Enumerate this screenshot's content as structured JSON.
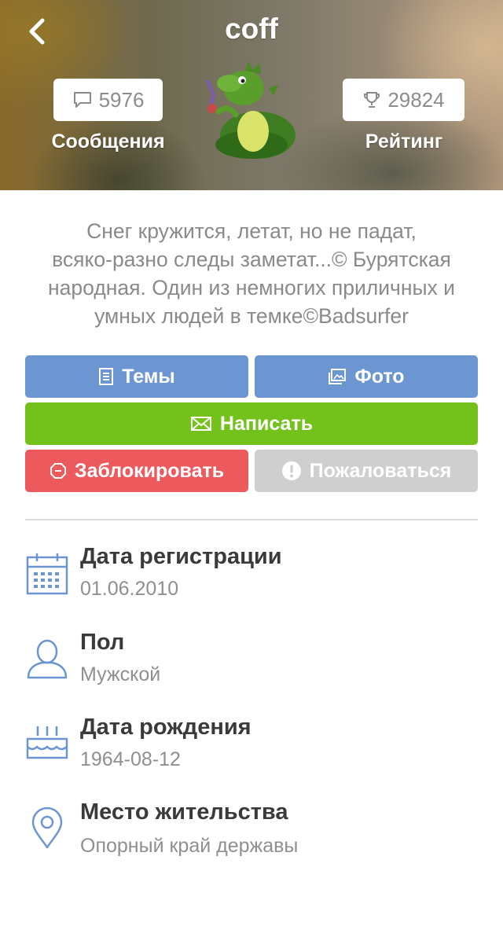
{
  "header": {
    "title": "coff",
    "messages": {
      "count": "5976",
      "label": "Сообщения"
    },
    "rating": {
      "count": "29824",
      "label": "Рейтинг"
    }
  },
  "bio": {
    "lines": [
      "Снег кружится, летат, но не падат,",
      "всяко-разно следы заметат...© Бурятская",
      "народная.  Один из немногих приличных и",
      "умных людей в темке©Badsurfer"
    ]
  },
  "actions": {
    "topics": "Темы",
    "photo": "Фото",
    "write": "Написать",
    "block": "Заблокировать",
    "report": "Пожаловаться"
  },
  "colors": {
    "blue": "#6b96d2",
    "green": "#73c21c",
    "red": "#ec5a5e",
    "gray": "#cfcfcf",
    "icon_blue": "#6b96d2"
  },
  "info": {
    "registration": {
      "title": "Дата регистрации",
      "value": "01.06.2010",
      "icon": "calendar-icon"
    },
    "gender": {
      "title": "Пол",
      "value": "Мужской",
      "icon": "person-icon"
    },
    "birthday": {
      "title": "Дата рождения",
      "value": "1964-08-12",
      "icon": "cake-icon"
    },
    "location": {
      "title": "Место жительства",
      "value": "Опорный край державы",
      "icon": "location-pin-icon"
    }
  }
}
